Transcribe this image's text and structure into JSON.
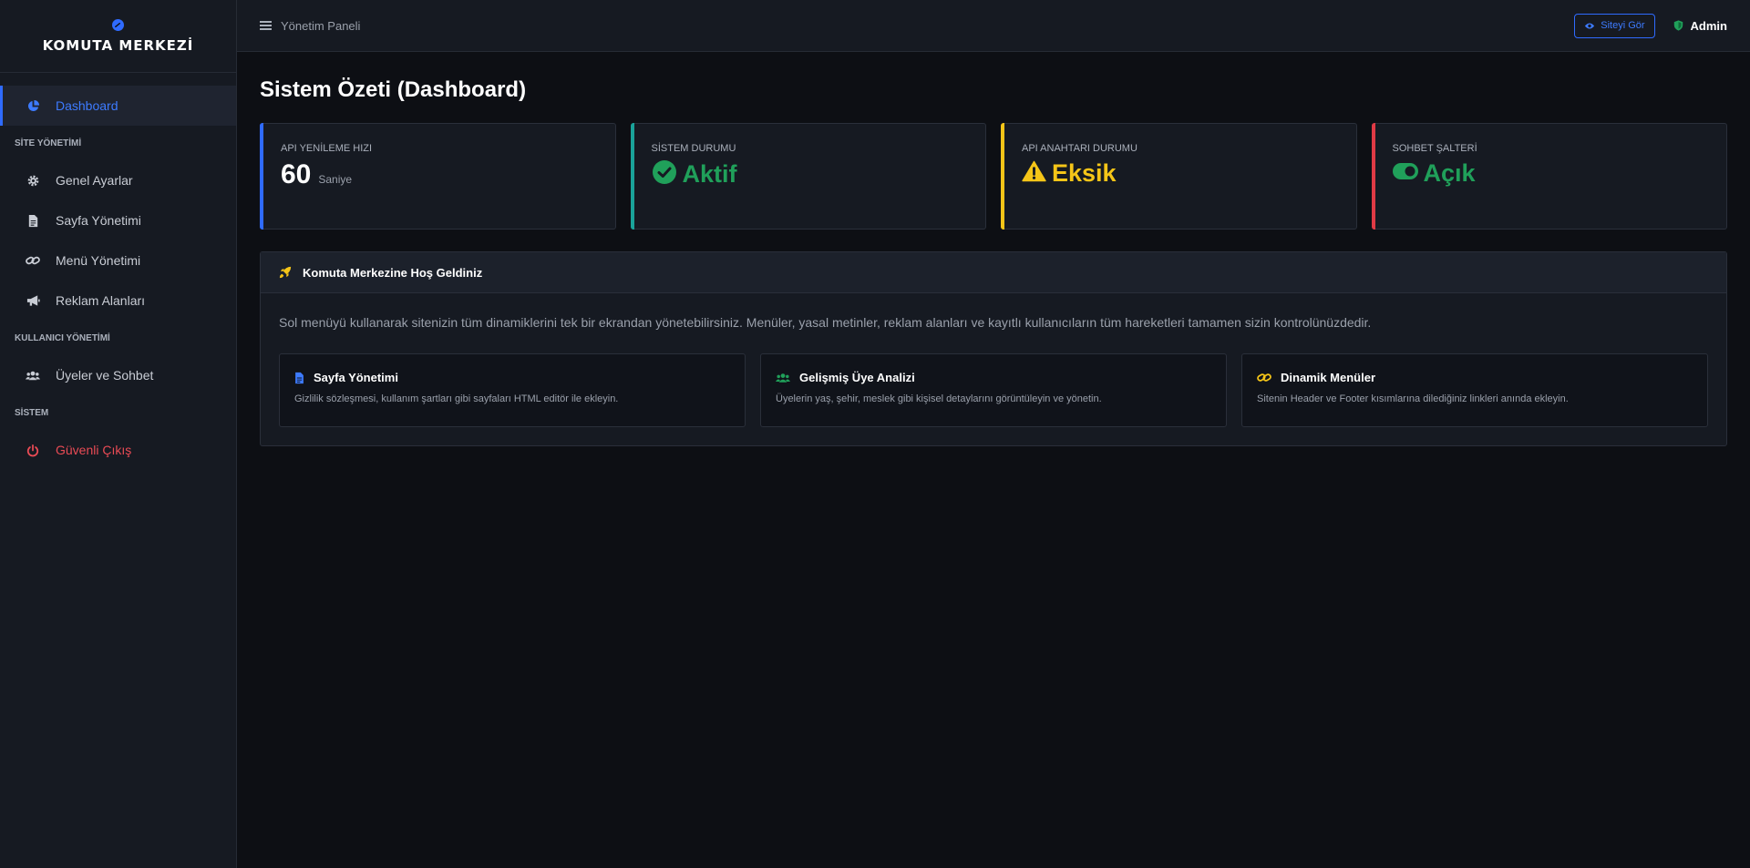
{
  "brand": {
    "title": "KOMUTA MERKEZİ",
    "accent": "#2f6bff"
  },
  "sidebar": {
    "items": [
      {
        "label": "Dashboard",
        "icon": "pie-chart-icon",
        "active": true
      },
      {
        "section": "SİTE YÖNETİMİ"
      },
      {
        "label": "Genel Ayarlar",
        "icon": "gear-icon"
      },
      {
        "label": "Sayfa Yönetimi",
        "icon": "file-icon"
      },
      {
        "label": "Menü Yönetimi",
        "icon": "link-icon"
      },
      {
        "label": "Reklam Alanları",
        "icon": "megaphone-icon"
      },
      {
        "section": "KULLANICI YÖNETİMİ"
      },
      {
        "label": "Üyeler ve Sohbet",
        "icon": "users-icon"
      },
      {
        "section": "SİSTEM"
      },
      {
        "label": "Güvenli Çıkış",
        "icon": "power-icon",
        "danger": true
      }
    ]
  },
  "topbar": {
    "title": "Yönetim Paneli",
    "view_site": "Siteyi Gör",
    "user": "Admin"
  },
  "page": {
    "title": "Sistem Özeti (Dashboard)"
  },
  "stats": [
    {
      "label": "API YENİLEME HIZI",
      "value": "60",
      "unit": "Saniye",
      "color": "#2f6bff"
    },
    {
      "label": "SİSTEM DURUMU",
      "value": "Aktif",
      "icon": "check-circle-icon",
      "color": "#1aa39a"
    },
    {
      "label": "API ANAHTARI DURUMU",
      "value": "Eksik",
      "icon": "warning-icon",
      "color": "#f5c518"
    },
    {
      "label": "SOHBET ŞALTERİ",
      "value": "Açık",
      "icon": "toggle-on-icon",
      "color": "#e03a45"
    }
  ],
  "welcome": {
    "title": "Komuta Merkezine Hoş Geldiniz",
    "text": "Sol menüyü kullanarak sitenizin tüm dinamiklerini tek bir ekrandan yönetebilirsiniz. Menüler, yasal metinler, reklam alanları ve kayıtlı kullanıcıların tüm hareketleri tamamen sizin kontrolünüzdedir.",
    "features": [
      {
        "title": "Sayfa Yönetimi",
        "desc": "Gizlilik sözleşmesi, kullanım şartları gibi sayfaları HTML editör ile ekleyin.",
        "icon": "file-icon"
      },
      {
        "title": "Gelişmiş Üye Analizi",
        "desc": "Üyelerin yaş, şehir, meslek gibi kişisel detaylarını görüntüleyin ve yönetin.",
        "icon": "users-icon"
      },
      {
        "title": "Dinamik Menüler",
        "desc": "Sitenin Header ve Footer kısımlarına dilediğiniz linkleri anında ekleyin.",
        "icon": "link-icon"
      }
    ]
  }
}
